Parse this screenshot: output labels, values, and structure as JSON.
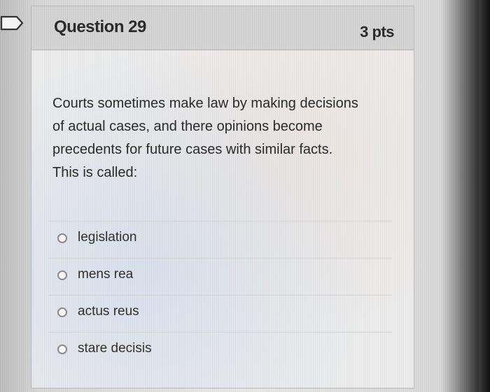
{
  "question": {
    "title": "Question 29",
    "points": "3 pts",
    "text_lines": [
      "Courts sometimes make law by making decisions",
      "of actual cases, and there opinions become",
      "precedents for future cases with similar facts.",
      "This is called:"
    ]
  },
  "answers": [
    {
      "label": "legislation",
      "selected": false
    },
    {
      "label": "mens rea",
      "selected": false
    },
    {
      "label": "actus reus",
      "selected": false
    },
    {
      "label": "stare decisis",
      "selected": false
    }
  ],
  "icons": {
    "bookmark": "bookmark-flag-icon"
  }
}
